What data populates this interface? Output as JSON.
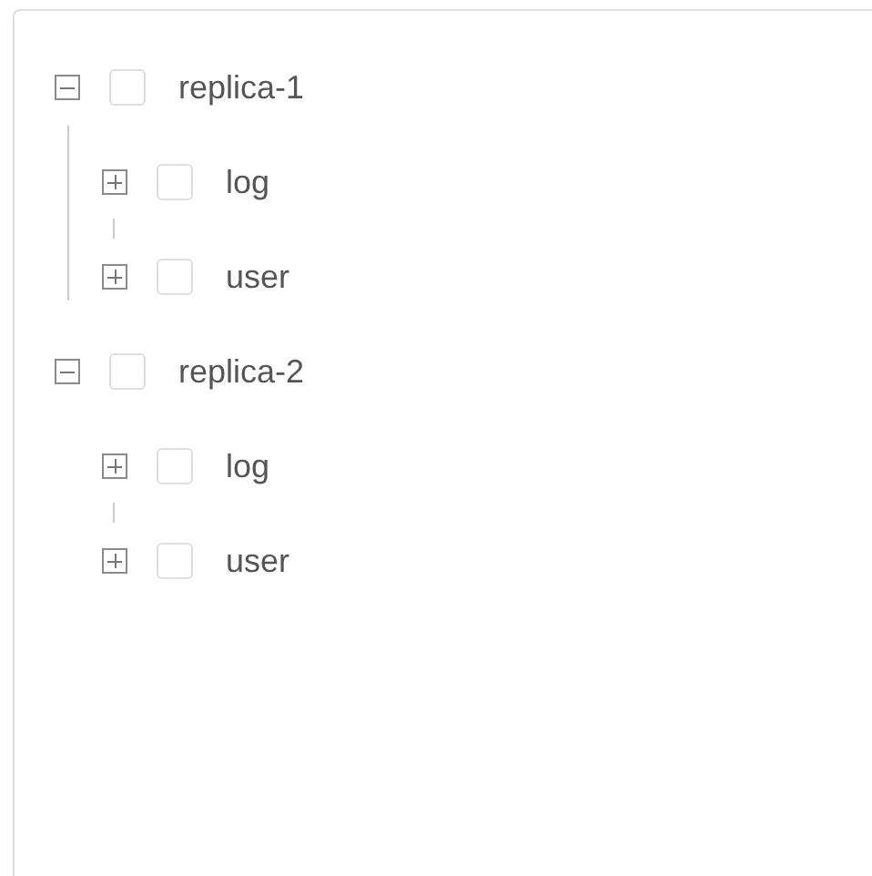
{
  "tree": [
    {
      "label": "replica-1",
      "expanded": true,
      "checked": false,
      "children": [
        {
          "label": "log",
          "expanded": false,
          "checked": false
        },
        {
          "label": "user",
          "expanded": false,
          "checked": false
        }
      ]
    },
    {
      "label": "replica-2",
      "expanded": true,
      "checked": false,
      "children": [
        {
          "label": "log",
          "expanded": false,
          "checked": false
        },
        {
          "label": "user",
          "expanded": false,
          "checked": false
        }
      ]
    }
  ]
}
